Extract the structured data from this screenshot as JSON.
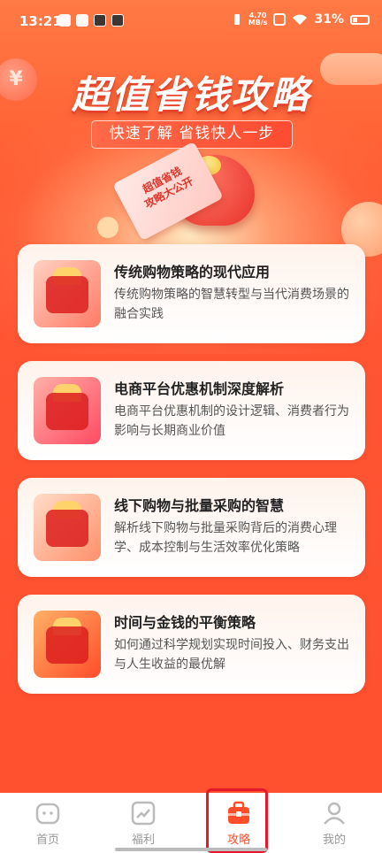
{
  "status_bar": {
    "time": "13:21",
    "net_speed_value": "4.70",
    "net_speed_unit": "MB/s",
    "battery": "31%"
  },
  "hero": {
    "title": "超值省钱攻略",
    "subtitle": "快速了解 省钱快人一步",
    "ticket_text_line1": "超值省钱",
    "ticket_text_line2": "攻略大公开",
    "coin_symbol": "¥"
  },
  "cards": [
    {
      "title": "传统购物策略的现代应用",
      "desc": "传统购物策略的智慧转型与当代消费场景的融合实践",
      "icon": "shopping-bag-illustration"
    },
    {
      "title": "电商平台优惠机制深度解析",
      "desc": "电商平台优惠机制的设计逻辑、消费者行为影响与长期商业价值",
      "icon": "gift-cart-illustration"
    },
    {
      "title": "线下购物与批量采购的智慧",
      "desc": "解析线下购物与批量采购背后的消费心理学、成本控制与生活效率优化策略",
      "icon": "gift-box-illustration"
    },
    {
      "title": "时间与金钱的平衡策略",
      "desc": "如何通过科学规划实现时间投入、财务支出与人生收益的最优解",
      "icon": "clock-illustration"
    }
  ],
  "bottom_nav": {
    "items": [
      {
        "label": "首页",
        "icon": "home-icon",
        "active": false
      },
      {
        "label": "福利",
        "icon": "trend-chart-icon",
        "active": false
      },
      {
        "label": "攻略",
        "icon": "toolbox-icon",
        "active": true
      },
      {
        "label": "我的",
        "icon": "person-icon",
        "active": false
      }
    ]
  },
  "colors": {
    "primary": "#ff4d2a",
    "highlight_box": "#e6192b",
    "card_bg": "#fff3ec"
  }
}
